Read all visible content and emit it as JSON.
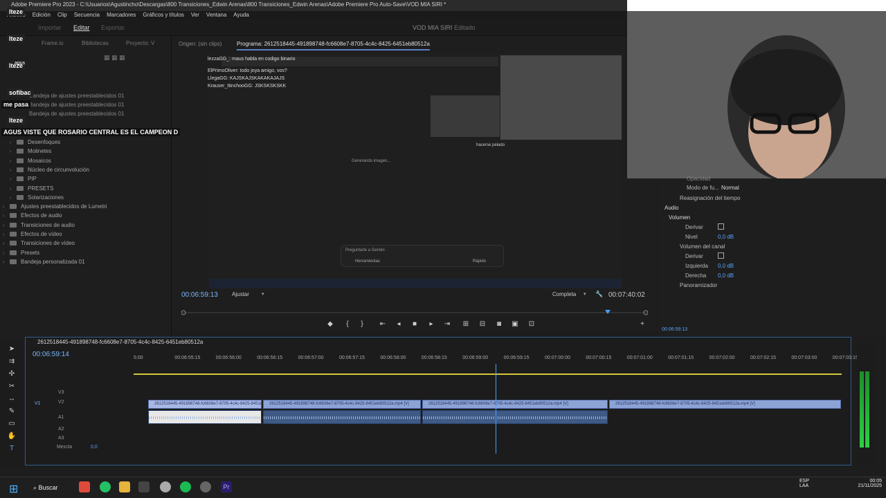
{
  "titlebar": {
    "title": "Adobe Premiere Pro 2023 - C:\\Usuarios\\Agustincho\\Descargas\\800 Transiciones_Edwin Arenas\\800 Transiciones_Edwin Arenas\\Adobe Premiere Pro Auto-Save\\VOD MIA SIRI *"
  },
  "menu": [
    "Archivo",
    "Edición",
    "Clip",
    "Secuencia",
    "Marcadores",
    "Gráficos y títulos",
    "Ver",
    "Ventana",
    "Ayuda"
  ],
  "workspace": {
    "tabs": [
      "Importar",
      "Editar",
      "Exportar"
    ],
    "project": "VOD MIA SIRI",
    "status": "Editado"
  },
  "leftpanel": {
    "tabs": [
      "Frame.io",
      "Bibliotecas",
      "Proyecto: V"
    ],
    "items": [
      {
        "label": "Desenfoques",
        "kind": "folder-arrow"
      },
      {
        "label": "Molinetes",
        "kind": "folder-arrow"
      },
      {
        "label": "Mosaicos",
        "kind": "folder-arrow"
      },
      {
        "label": "Núcleo de circunvolución",
        "kind": "folder-arrow"
      },
      {
        "label": "PIP",
        "kind": "folder-arrow"
      },
      {
        "label": "PRESETS",
        "kind": "folder-arrow"
      },
      {
        "label": "Solarizaciones",
        "kind": "folder-arrow"
      },
      {
        "label": "Ajustes preestablecidos de Lumetri",
        "kind": "folder"
      },
      {
        "label": "Efectos de audio",
        "kind": "folder"
      },
      {
        "label": "Transiciones de audio",
        "kind": "folder"
      },
      {
        "label": "Efectos de vídeo",
        "kind": "folder"
      },
      {
        "label": "Transiciones de vídeo",
        "kind": "folder"
      },
      {
        "label": "Presets",
        "kind": "folder"
      },
      {
        "label": "Bandeja personalizada 01",
        "kind": "folder"
      }
    ],
    "bandeja": [
      "Bandeja de ajustes preestablecidos 01",
      "Bandeja de ajustes preestablecidos 01",
      "Bandeja de ajustes preestablecidos 01"
    ]
  },
  "chat_overlay": [
    {
      "name": "lteze",
      "msg": ""
    },
    {
      "name": "lteze",
      "msg": ""
    },
    {
      "name": "lteze",
      "msg": "agus"
    },
    {
      "name": "sofibac",
      "msg": "me pasa"
    },
    {
      "name": "lteze",
      "msg": "AGUS VISTE QUE ROSARIO CENTRAL ES EL CAMPEON D"
    }
  ],
  "program": {
    "source_tab": "Origen: (sin clips)",
    "tab": "Programa: 2612518445-491898748-fc6608e7-8705-4c4c-8425-6451eb80512a",
    "timecode_left": "00:06:59:13",
    "fit": "Ajustar",
    "quality": "Completa",
    "timecode_right": "00:07:40:02"
  },
  "video_chat": [
    "lezzaGG_: maus habla en codigo binario",
    "ElPrimoOliver: todo joya amigo, vos?",
    "LlegaGG: KAJSKAJSKAKAKAJAJS",
    "Krauser_ttinchooGG: JSKSKSKSKK"
  ],
  "video": {
    "generating": "Generando imagen...",
    "ask": "Preguntarle a Gemini",
    "tools": "Herramientas",
    "mode": "Rápido",
    "caption": "hacerse pelado"
  },
  "effects": {
    "opacity": "Opacidad",
    "blend_label": "Modo de fu...",
    "blend_value": "Normal",
    "remap": "Reasignación del tiempo",
    "audio": "Audio",
    "volume": "Volumen",
    "bypass": "Derivar",
    "level": "Nivel",
    "level_val": "0,0 dB",
    "channel_volume": "Volumen del canal",
    "left": "Izquierda",
    "left_val": "0,0 dB",
    "right": "Derecha",
    "right_val": "0,0 dB",
    "panner": "Panoramizador",
    "timecode": "00:06:59:13"
  },
  "timeline": {
    "tab": "2612518445-491898748-fc6608e7-8705-4c4c-8425-6451eb80512a",
    "timecode": "00:06:59:14",
    "ruler": [
      "5:00",
      "00:06:55:15",
      "00:06:56:00",
      "00:06:56:15",
      "00:06:57:00",
      "00:06:57:15",
      "00:06:58:00",
      "00:06:58:15",
      "00:06:59:00",
      "00:06:59:15",
      "00:07:00:00",
      "00:07:00:15",
      "00:07:01:00",
      "00:07:01:15",
      "00:07:02:00",
      "00:07:02:15",
      "00:07:03:00",
      "00:07:03:15"
    ],
    "tracks": [
      "V3",
      "V2",
      "V1",
      "A1",
      "A2",
      "A3"
    ],
    "mix": "Mezcla",
    "mix_val": "0,0",
    "clip_name": "2612518445-491898748-fc6608e7-8705-4c4c-8425-6451eb80512a.mp4 [V]"
  },
  "taskbar": {
    "search": "Buscar",
    "lang1": "ESP",
    "lang2": "LAA",
    "time": "00:05",
    "date": "21/11/2025"
  }
}
